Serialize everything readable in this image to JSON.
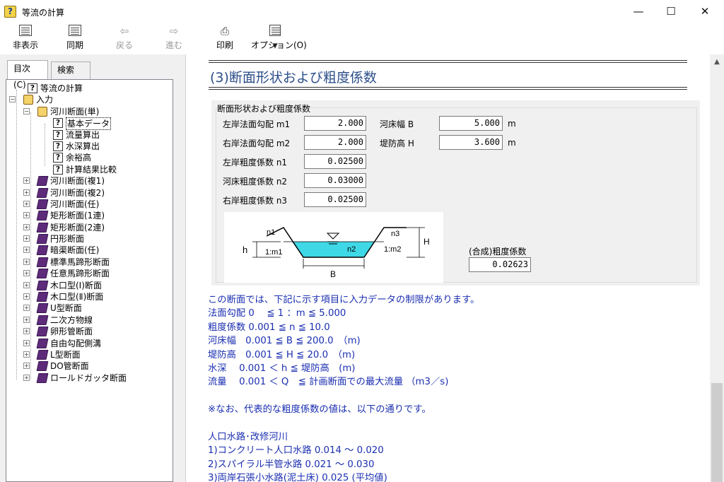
{
  "window": {
    "title": "等流の計算",
    "minimize": "—",
    "maximize": "☐",
    "close": "✕"
  },
  "toolbar": {
    "hide_label": "非表示",
    "sync_label": "同期",
    "back_label": "戻る",
    "forward_label": "進む",
    "print_label": "印刷",
    "options_label": "オプション(O)"
  },
  "tabs": {
    "contents": "目次(C)",
    "search": "検索(S)"
  },
  "tree": {
    "root": "等流の計算",
    "input": "入力",
    "river_single": "河川断面(単)",
    "leaves": [
      "基本データ",
      "流量算出",
      "水深算出",
      "余裕高",
      "計算結果比較"
    ],
    "books": [
      "河川断面(複1)",
      "河川断面(複2)",
      "河川断面(任)",
      "矩形断面(1連)",
      "矩形断面(2連)",
      "円形断面",
      "暗渠断面(任)",
      "標準馬蹄形断面",
      "任意馬蹄形断面",
      "木口型(Ⅰ)断面",
      "木口型(Ⅱ)断面",
      "U型断面",
      "二次方物線",
      "卵形管断面",
      "自由勾配側溝",
      "L型断面",
      "DO管断面",
      "ロールドガッタ断面"
    ]
  },
  "content": {
    "heading": "(3)断面形状および粗度係数",
    "group_title": "断面形状および粗度係数",
    "left_slope_label": "左岸法面勾配 m1",
    "left_slope": "2.000",
    "right_slope_label": "右岸法面勾配 m2",
    "right_slope": "2.000",
    "n1_label": "左岸粗度係数 n1",
    "n1": "0.02500",
    "n2_label": "河床粗度係数 n2",
    "n2": "0.03000",
    "n3_label": "右岸粗度係数 n3",
    "n3": "0.02500",
    "bed_width_label": "河床幅 B",
    "bed_width": "5.000",
    "bank_height_label": "堤防高 H",
    "bank_height": "3.600",
    "unit_m": "m",
    "composite_label": "(合成)粗度係数",
    "composite": "0.02623",
    "diagram": {
      "n1": "n1",
      "n2": "n2",
      "n3": "n3",
      "h": "h",
      "H": "H",
      "B": "B",
      "m1": "1:m1",
      "m2": "1:m2"
    }
  },
  "notes": [
    "この断面では、下記に示す項目に入力データの制限があります。",
    "法面勾配 0　 ≦ 1 ：m ≦ 5.000",
    "粗度係数 0.001 ≦ n ≦ 10.0",
    "河床幅　0.001 ≦ B ≦ 200.0　（m)",
    "堤防高　0.001 ≦ H ≦ 20.0　（m)",
    "水深　 0.001 ＜ h ≦ 堤防高　(m)",
    "流量　 0.001 ＜ Q　≦ 計画断面での最大流量 （m3／s)",
    "",
    "※なお、代表的な粗度係数の値は、以下の通りです。",
    "",
    "人口水路･改修河川",
    "1)コンクリート人口水路 0.014 ～ 0.020",
    "2)スパイラル半管水路 0.021 ～ 0.030",
    "3)両岸石張小水路(泥土床) 0.025 (平均値)"
  ]
}
